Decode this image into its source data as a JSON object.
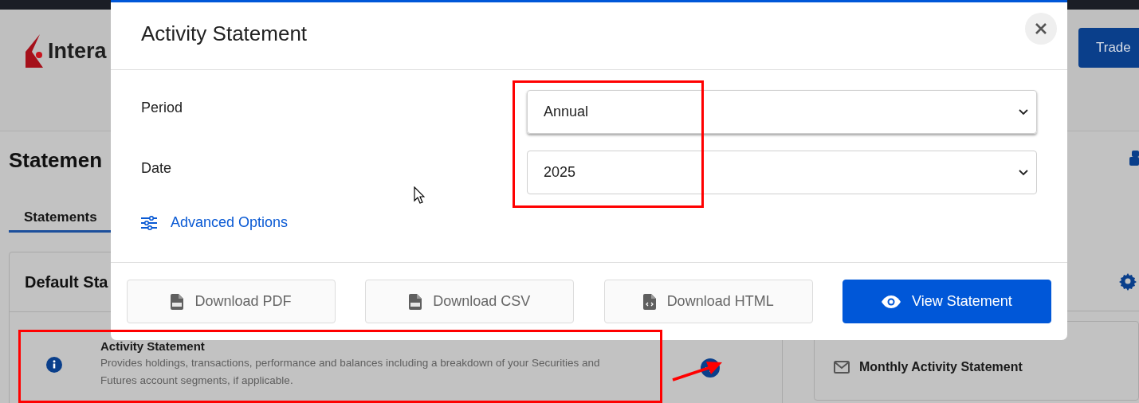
{
  "page": {
    "logo_text": "Intera",
    "trade_button": "Trade",
    "title": "Statemen",
    "tabs": [
      {
        "label": "Statements",
        "selected": true
      }
    ],
    "default_card": {
      "title": "Default Sta",
      "rows": [
        {
          "title": "Activity Statement",
          "description": "Provides holdings, transactions, performance and balances including a breakdown of your Securities and Futures account segments, if applicable."
        }
      ]
    },
    "side_card": {
      "items": [
        "Monthly Activity Statement"
      ]
    }
  },
  "modal": {
    "title": "Activity Statement",
    "fields": [
      {
        "label": "Period",
        "value": "Annual",
        "focused": true
      },
      {
        "label": "Date",
        "value": "2025",
        "focused": false
      }
    ],
    "advanced_link": "Advanced Options",
    "buttons": [
      {
        "label": "Download PDF",
        "kind": "pdf"
      },
      {
        "label": "Download CSV",
        "kind": "csv"
      },
      {
        "label": "Download HTML",
        "kind": "html"
      },
      {
        "label": "View Statement",
        "kind": "view"
      }
    ]
  }
}
